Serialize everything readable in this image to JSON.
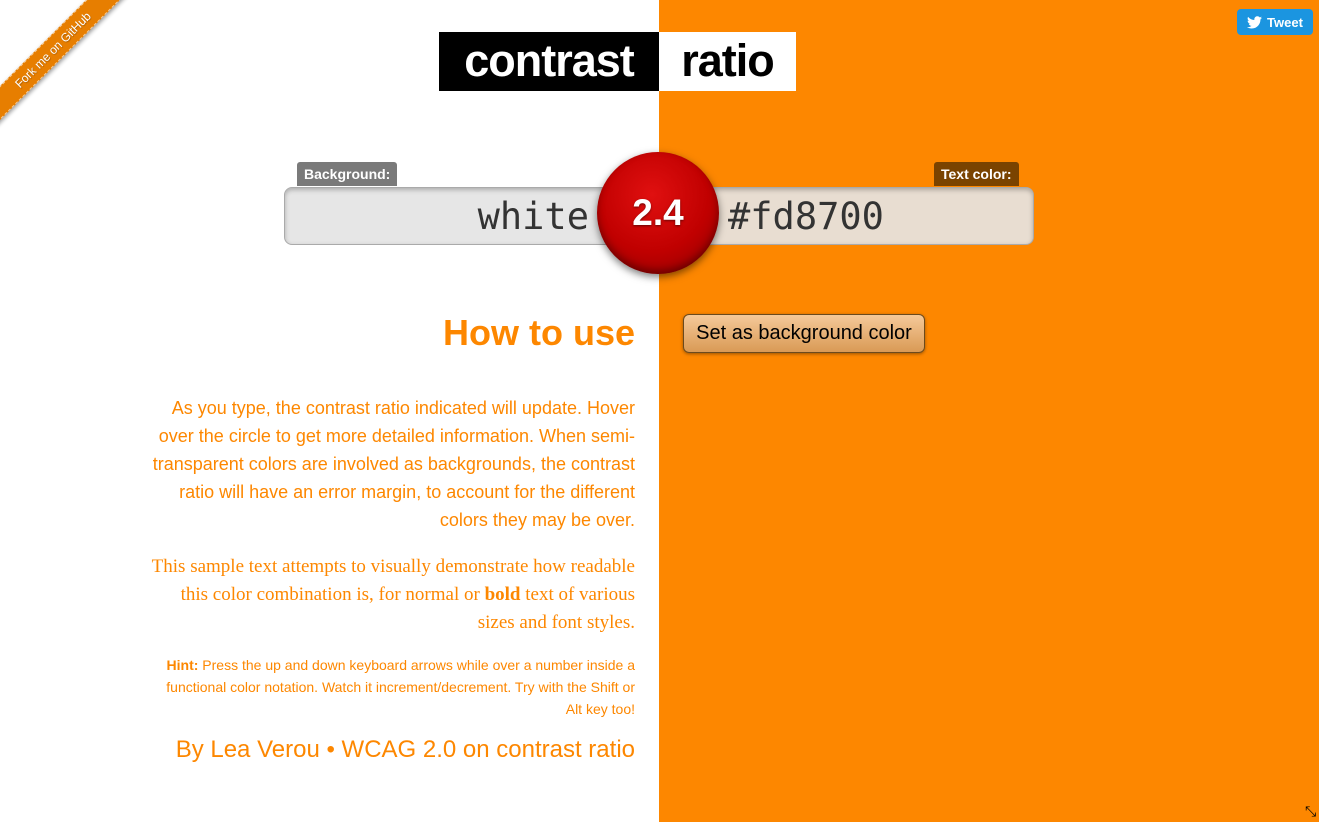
{
  "ribbon": {
    "label": "Fork me on GitHub"
  },
  "tweet": {
    "label": "Tweet"
  },
  "title": {
    "part1": "contrast",
    "part2": "ratio"
  },
  "background_field": {
    "label": "Background:",
    "value": "white"
  },
  "text_field": {
    "label": "Text color:",
    "value": "#fd8700"
  },
  "ratio": {
    "value": "2.4"
  },
  "swap_button": {
    "label": "Set as background color"
  },
  "how_to": {
    "heading": "How to use",
    "paragraph": "As you type, the contrast ratio indicated will update. Hover over the circle to get more detailed information. When semi-transparent colors are involved as backgrounds, the contrast ratio will have an error margin, to account for the different colors they may be over.",
    "sample_before": "This sample text attempts to visually demonstrate how readable this color combination is, for normal or ",
    "sample_bold": "bold",
    "sample_after": " text of various sizes and font styles.",
    "hint_label": "Hint:",
    "hint_text": " Press the up and down keyboard arrows while over a number inside a functional color notation. Watch it increment/decrement. Try with the Shift or Alt key too!"
  },
  "byline": {
    "author": "By Lea Verou",
    "separator": " • ",
    "link": "WCAG 2.0 on contrast ratio"
  },
  "colors": {
    "accent": "#fd8700",
    "ratio_circle": "#c00000",
    "bg_label": "#7a7a7a",
    "fg_label": "#7a4300"
  }
}
